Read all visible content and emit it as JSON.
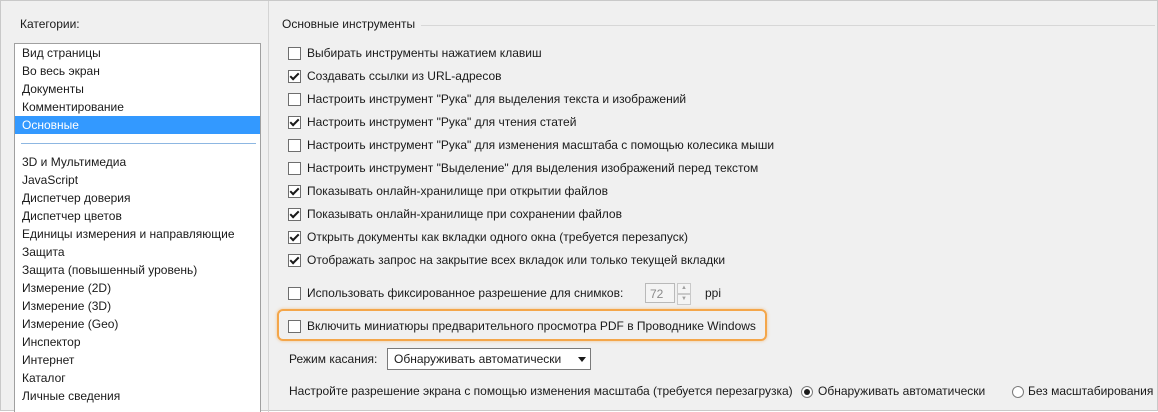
{
  "categories": {
    "title": "Категории:",
    "group1": [
      "Вид страницы",
      "Во весь экран",
      "Документы",
      "Комментирование",
      "Основные"
    ],
    "selected": "Основные",
    "group2": [
      "3D и Мультимедиа",
      "JavaScript",
      "Диспетчер доверия",
      "Диспетчер цветов",
      "Единицы измерения и направляющие",
      "Защита",
      "Защита (повышенный уровень)",
      "Измерение (2D)",
      "Измерение (3D)",
      "Измерение (Geo)",
      "Инспектор",
      "Интернет",
      "Каталог",
      "Личные сведения"
    ]
  },
  "section": {
    "title": "Основные инструменты",
    "options": [
      {
        "label": "Выбирать инструменты нажатием клавиш",
        "checked": false
      },
      {
        "label": "Создавать ссылки из URL-адресов",
        "checked": true
      },
      {
        "label": "Настроить инструмент \"Рука\" для выделения текста и изображений",
        "checked": false
      },
      {
        "label": "Настроить инструмент \"Рука\" для чтения статей",
        "checked": true
      },
      {
        "label": "Настроить инструмент \"Рука\" для изменения масштаба с помощью колесика мыши",
        "checked": false
      },
      {
        "label": "Настроить инструмент \"Выделение\" для выделения изображений перед текстом",
        "checked": false
      },
      {
        "label": "Показывать онлайн-хранилище при открытии файлов",
        "checked": true
      },
      {
        "label": "Показывать онлайн-хранилище при сохранении файлов",
        "checked": true
      },
      {
        "label": "Открыть документы как вкладки одного окна (требуется перезапуск)",
        "checked": true
      },
      {
        "label": "Отображать запрос на закрытие всех вкладок или только текущей вкладки",
        "checked": true
      }
    ],
    "fixed_resolution": {
      "label": "Использовать фиксированное разрешение для снимков:",
      "checked": false,
      "value": "72",
      "unit": "ppi"
    },
    "pdf_preview": {
      "label": "Включить миниатюры предварительного просмотра PDF в Проводнике Windows",
      "checked": false
    },
    "touch_mode": {
      "label": "Режим касания:",
      "value": "Обнаруживать автоматически"
    },
    "scaling": {
      "label": "Настройте разрешение экрана с помощью изменения масштаба (требуется перезагрузка)",
      "options": [
        {
          "label": "Обнаруживать автоматически",
          "checked": true
        },
        {
          "label": "Без масштабирования",
          "checked": false
        }
      ]
    }
  }
}
